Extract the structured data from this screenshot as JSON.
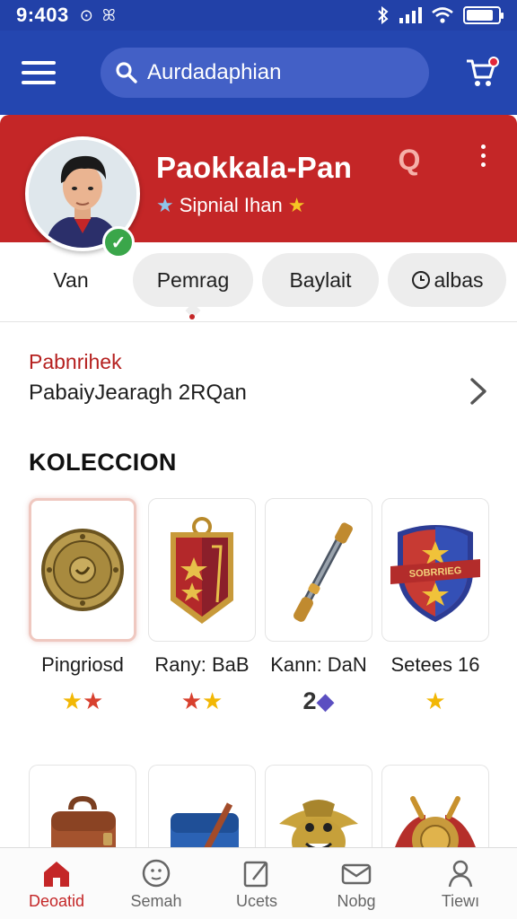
{
  "status_bar": {
    "time": "9:403",
    "battery_level": 0.85
  },
  "app_bar": {
    "search_value": "Aurdadaphian",
    "search_icon": "search-icon",
    "menu_icon": "hamburger-menu-icon",
    "cart_icon": "cart-icon"
  },
  "profile": {
    "name": "Paokkala-Pan",
    "subtitle": "Sipnial Ihan",
    "badge_glyph": "Q",
    "accent_color": "#c42627",
    "brand_color": "#2446b0"
  },
  "tabs": [
    {
      "label": "Van"
    },
    {
      "label": "Pemrag"
    },
    {
      "label": "Baylait"
    },
    {
      "label": "albas"
    }
  ],
  "info": {
    "label": "Pabnrihek",
    "value": "PabaiyJearagh 2RQan"
  },
  "collection": {
    "title": "KOLECCION",
    "items": [
      {
        "name": "Pingriosd",
        "rating": "gold-red",
        "icon": "round-shield-icon"
      },
      {
        "name": "Rany: BaB",
        "rating": "red-gold",
        "icon": "shield-banner-icon"
      },
      {
        "name": "Kann: DaN",
        "rating_number": "2",
        "rating": "number-badge",
        "icon": "staff-icon"
      },
      {
        "name": "Setees 16",
        "rating": "gold",
        "icon": "crest-shield-icon"
      }
    ],
    "crest_text": "SOBRRIEG",
    "second_row_icons": [
      "backpack-icon",
      "satchel-icon",
      "creature-icon",
      "winged-shield-icon"
    ]
  },
  "bottom_nav": [
    {
      "label": "Deoatid",
      "icon": "home-icon",
      "active": true
    },
    {
      "label": "Semah",
      "icon": "search-face-icon",
      "active": false
    },
    {
      "label": "Ucets",
      "icon": "edit-icon",
      "active": false
    },
    {
      "label": "Nobg",
      "icon": "mail-icon",
      "active": false
    },
    {
      "label": "Tiewı",
      "icon": "profile-icon",
      "active": false
    }
  ]
}
